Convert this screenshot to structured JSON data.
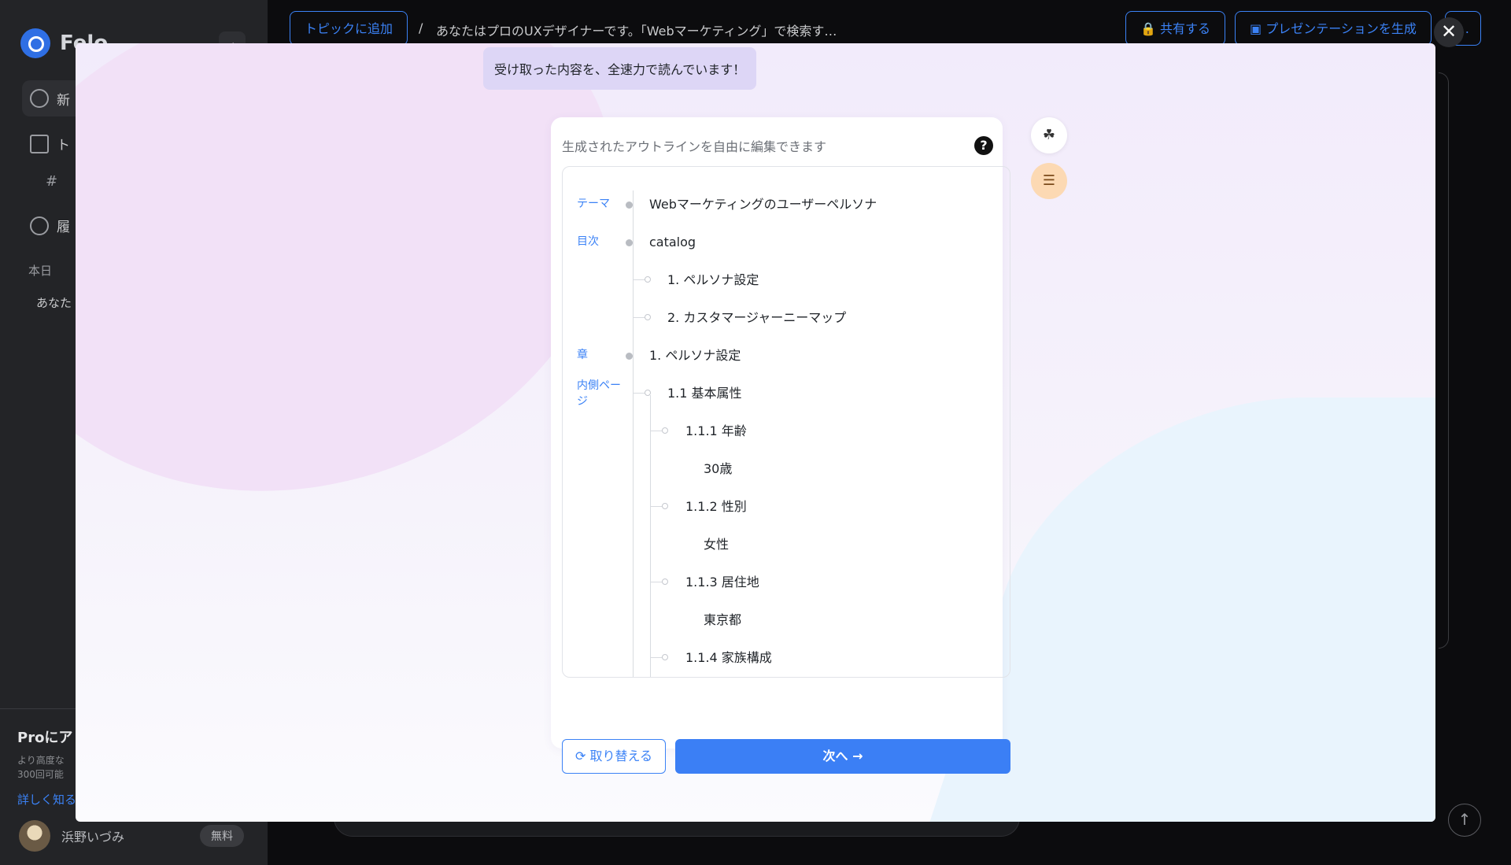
{
  "sidebar": {
    "logo_text": "Felo",
    "items": [
      {
        "label": "新"
      },
      {
        "label": "ト"
      },
      {
        "label": "履"
      }
    ],
    "hash_label": "#",
    "section_today": "本日",
    "history_item": "あなた",
    "pro_title": "Proにア",
    "pro_desc_line1": "より高度な",
    "pro_desc_line2": "300回可能",
    "pro_link": "詳しく知る",
    "user_name": "浜野いづみ",
    "plan_badge": "無料"
  },
  "topbar": {
    "add_topic": "トピックに追加",
    "breadcrumb_sep": "/",
    "breadcrumb": "あなたはプロのUXデザイナーです。「Webマーケティング」で検索す…",
    "share": "共有する",
    "presentation": "プレゼンテーションを生成",
    "more": "…"
  },
  "modal": {
    "toast": "受け取った内容を、全速力で読んでいます！",
    "hint": "生成されたアウトラインを自由に編集できます",
    "outline": {
      "theme_label": "テーマ",
      "theme_value": "Webマーケティングのユーザーペルソナ",
      "toc_label": "目次",
      "toc_value": "catalog",
      "toc_items": [
        "1. ペルソナ設定",
        "2. カスタマージャーニーマップ"
      ],
      "chapter_label": "章",
      "chapter_value": "1. ペルソナ設定",
      "inner_label_1": "内側ペー",
      "inner_label_2": "ジ",
      "section": "1.1 基本属性",
      "sub_items": [
        {
          "title": "1.1.1 年齢",
          "value": "30歳"
        },
        {
          "title": "1.1.2 性別",
          "value": "女性"
        },
        {
          "title": "1.1.3 居住地",
          "value": "東京都"
        },
        {
          "title": "1.1.4 家族構成"
        }
      ]
    },
    "replace_button": "取り替える",
    "next_button": "次へ →",
    "close": "✕"
  }
}
